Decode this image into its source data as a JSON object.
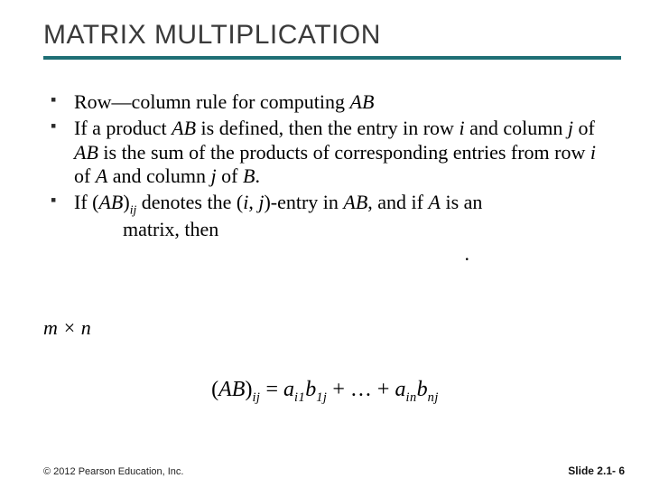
{
  "title": "MATRIX MULTIPLICATION",
  "bullets": {
    "b1_pre": "Row—column rule for computing ",
    "b1_AB": "AB",
    "b2_p1": "If a product ",
    "b2_AB1": "AB",
    "b2_p2": " is defined, then the entry in row ",
    "b2_i": "i",
    "b2_p3": " and column ",
    "b2_j": "j",
    "b2_p4": " of ",
    "b2_AB2": "AB",
    "b2_p5": " is the sum of the products of corresponding entries from row ",
    "b2_i2": "i",
    "b2_p6": " of ",
    "b2_A": "A",
    "b2_p7": " and column ",
    "b2_j2": "j",
    "b2_p8": " of ",
    "b2_B": "B",
    "b2_p9": ".",
    "b3_p1": "If (",
    "b3_AB": "AB",
    "b3_p2": ")",
    "b3_ij": "ij",
    "b3_p3": " denotes the (",
    "b3_i": "i",
    "b3_p4": ", ",
    "b3_j": "j",
    "b3_p5": ")-entry in ",
    "b3_AB2": "AB",
    "b3_p6": ", and if ",
    "b3_A": "A",
    "b3_p7": " is an",
    "b3_line2a": "matrix, then",
    "b3_dot": "."
  },
  "mxn": "m × n",
  "formula": {
    "lpar": "(",
    "AB": "AB",
    "rpar": ")",
    "ij": "ij",
    "eq": " = ",
    "a1": "a",
    "a1sub": "i1",
    "b1": "b",
    "b1sub": "1j",
    "plus1": " + … + ",
    "an": "a",
    "ansub": "in",
    "bn": "b",
    "bnsub": "nj"
  },
  "footer": {
    "copyright": "© 2012 Pearson Education, Inc.",
    "slide": "Slide 2.1- 6"
  }
}
